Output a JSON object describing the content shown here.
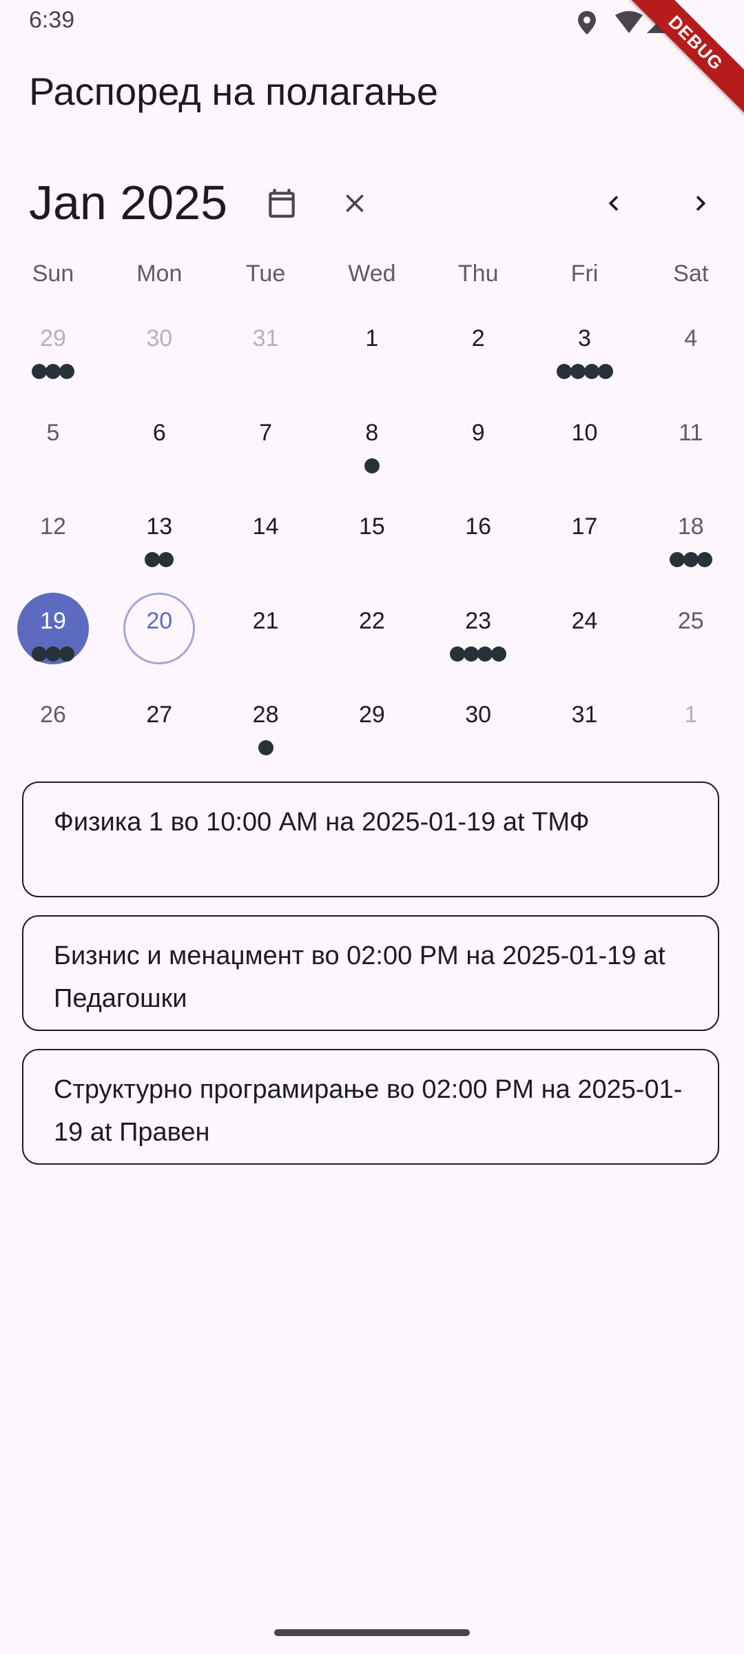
{
  "status_bar": {
    "time": "6:39"
  },
  "debug_banner": {
    "label": "DEBUG"
  },
  "app_title": "Распоред на полагање",
  "calendar": {
    "month_title": "Jan 2025",
    "weekdays": [
      "Sun",
      "Mon",
      "Tue",
      "Wed",
      "Thu",
      "Fri",
      "Sat"
    ],
    "weeks": [
      [
        {
          "day": "29",
          "outside": true,
          "markers": 3
        },
        {
          "day": "30",
          "outside": true,
          "markers": 0
        },
        {
          "day": "31",
          "outside": true,
          "markers": 0
        },
        {
          "day": "1",
          "outside": false,
          "markers": 0
        },
        {
          "day": "2",
          "outside": false,
          "markers": 0
        },
        {
          "day": "3",
          "outside": false,
          "markers": 4
        },
        {
          "day": "4",
          "outside": false,
          "markers": 0
        }
      ],
      [
        {
          "day": "5",
          "outside": false,
          "markers": 0
        },
        {
          "day": "6",
          "outside": false,
          "markers": 0
        },
        {
          "day": "7",
          "outside": false,
          "markers": 0
        },
        {
          "day": "8",
          "outside": false,
          "markers": 1
        },
        {
          "day": "9",
          "outside": false,
          "markers": 0
        },
        {
          "day": "10",
          "outside": false,
          "markers": 0
        },
        {
          "day": "11",
          "outside": false,
          "markers": 0
        }
      ],
      [
        {
          "day": "12",
          "outside": false,
          "markers": 0
        },
        {
          "day": "13",
          "outside": false,
          "markers": 2
        },
        {
          "day": "14",
          "outside": false,
          "markers": 0
        },
        {
          "day": "15",
          "outside": false,
          "markers": 0
        },
        {
          "day": "16",
          "outside": false,
          "markers": 0
        },
        {
          "day": "17",
          "outside": false,
          "markers": 0
        },
        {
          "day": "18",
          "outside": false,
          "markers": 3
        }
      ],
      [
        {
          "day": "19",
          "outside": false,
          "markers": 3,
          "selected": true
        },
        {
          "day": "20",
          "outside": false,
          "markers": 0,
          "today": true
        },
        {
          "day": "21",
          "outside": false,
          "markers": 0
        },
        {
          "day": "22",
          "outside": false,
          "markers": 0
        },
        {
          "day": "23",
          "outside": false,
          "markers": 4
        },
        {
          "day": "24",
          "outside": false,
          "markers": 0
        },
        {
          "day": "25",
          "outside": false,
          "markers": 0
        }
      ],
      [
        {
          "day": "26",
          "outside": false,
          "markers": 0
        },
        {
          "day": "27",
          "outside": false,
          "markers": 0
        },
        {
          "day": "28",
          "outside": false,
          "markers": 1
        },
        {
          "day": "29",
          "outside": false,
          "markers": 0
        },
        {
          "day": "30",
          "outside": false,
          "markers": 0
        },
        {
          "day": "31",
          "outside": false,
          "markers": 0
        },
        {
          "day": "1",
          "outside": true,
          "markers": 0
        }
      ]
    ]
  },
  "events": [
    "Физика 1 во 10:00 AM на 2025-01-19 at ТМФ",
    "Бизнис и менаџмент во 02:00 PM на 2025-01-19 at Педагошки",
    "Структурно програмирање во 02:00 PM на 2025-01-19 at Правен"
  ],
  "icons": {
    "calendar": "calendar-icon",
    "close": "close-icon",
    "prev": "chevron-left-icon",
    "next": "chevron-right-icon"
  },
  "colors": {
    "background": "#fdf7fd",
    "selected": "#5c6bc0",
    "today_border": "#9fa8da",
    "marker": "#263238",
    "debug": "#b71c1c"
  }
}
